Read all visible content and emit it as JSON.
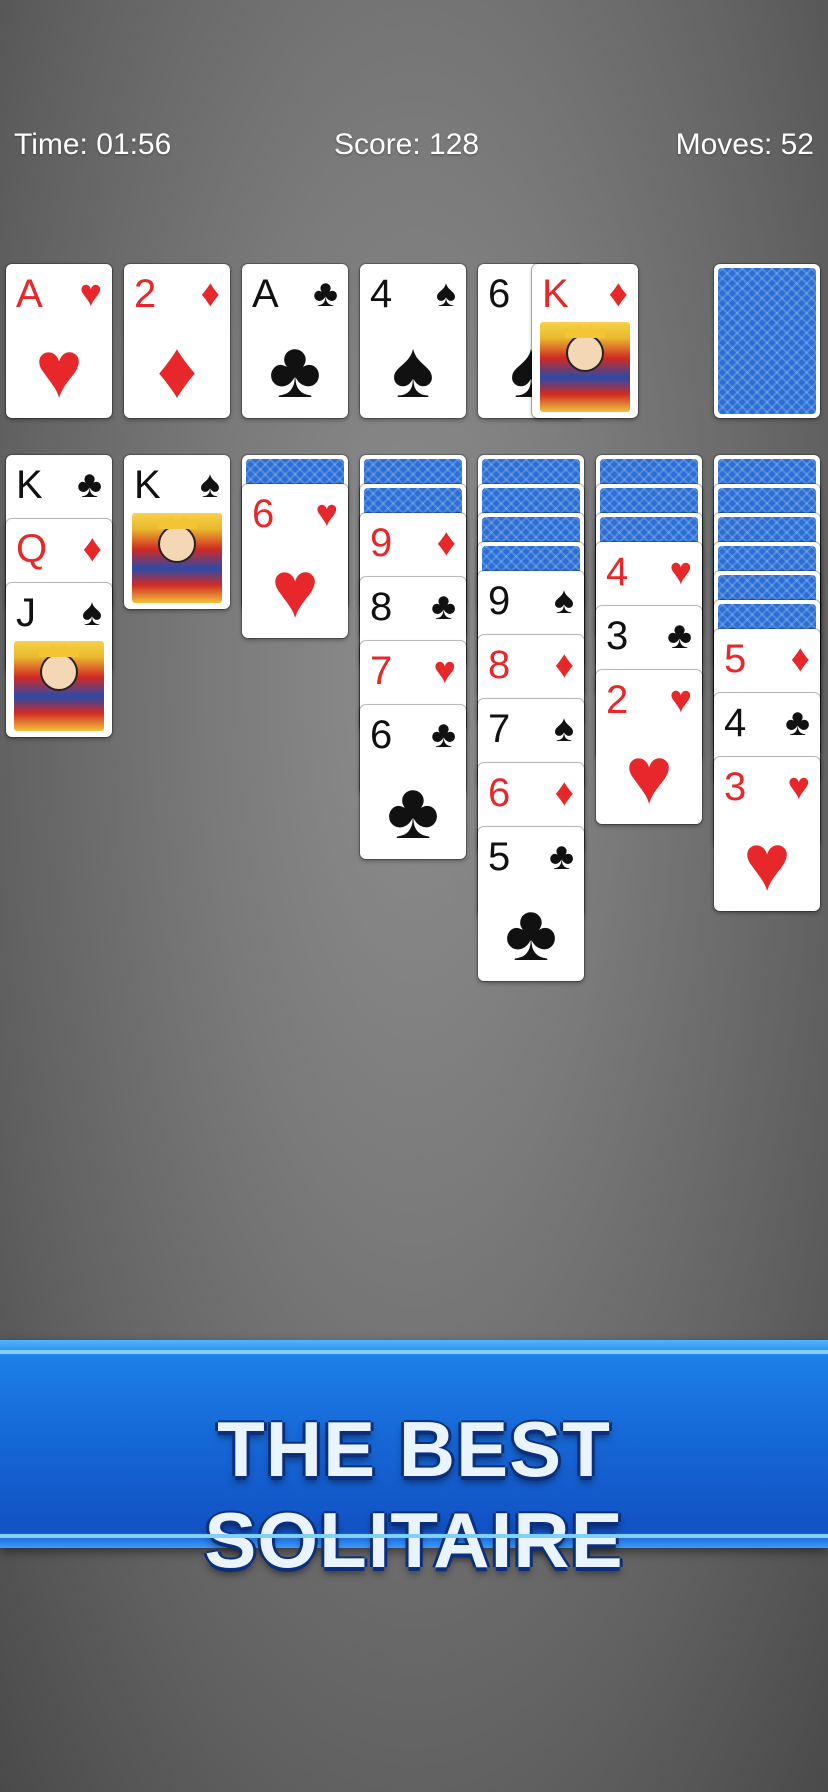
{
  "hud": {
    "time": "Time: 01:56",
    "score": "Score: 128",
    "moves": "Moves: 52"
  },
  "colors": {
    "red_suit": "#e8272b",
    "black_suit": "#111111",
    "card_back": "#2b6fd6",
    "banner": "#1666d6"
  },
  "foundations": [
    {
      "rank": "A",
      "suit": "♥",
      "color": "red"
    },
    {
      "rank": "2",
      "suit": "♦",
      "color": "red"
    },
    {
      "rank": "A",
      "suit": "♣",
      "color": "black"
    },
    {
      "rank": "4",
      "suit": "♠",
      "color": "black"
    }
  ],
  "waste": [
    {
      "rank": "6",
      "suit": "♠",
      "color": "black"
    },
    {
      "rank": "K",
      "suit": "♦",
      "color": "red",
      "face": true
    }
  ],
  "stock": {
    "face_down": true
  },
  "tableau": [
    {
      "hidden": 0,
      "cards": [
        {
          "rank": "K",
          "suit": "♣",
          "color": "black"
        },
        {
          "rank": "Q",
          "suit": "♦",
          "color": "red"
        },
        {
          "rank": "J",
          "suit": "♠",
          "color": "black",
          "face": true
        }
      ]
    },
    {
      "hidden": 0,
      "cards": [
        {
          "rank": "K",
          "suit": "♠",
          "color": "black",
          "face": true
        }
      ]
    },
    {
      "hidden": 1,
      "cards": [
        {
          "rank": "6",
          "suit": "♥",
          "color": "red"
        }
      ]
    },
    {
      "hidden": 2,
      "cards": [
        {
          "rank": "9",
          "suit": "♦",
          "color": "red"
        },
        {
          "rank": "8",
          "suit": "♣",
          "color": "black"
        },
        {
          "rank": "7",
          "suit": "♥",
          "color": "red"
        },
        {
          "rank": "6",
          "suit": "♣",
          "color": "black"
        }
      ]
    },
    {
      "hidden": 4,
      "cards": [
        {
          "rank": "9",
          "suit": "♠",
          "color": "black"
        },
        {
          "rank": "8",
          "suit": "♦",
          "color": "red"
        },
        {
          "rank": "7",
          "suit": "♠",
          "color": "black"
        },
        {
          "rank": "6",
          "suit": "♦",
          "color": "red"
        },
        {
          "rank": "5",
          "suit": "♣",
          "color": "black"
        }
      ]
    },
    {
      "hidden": 3,
      "cards": [
        {
          "rank": "4",
          "suit": "♥",
          "color": "red"
        },
        {
          "rank": "3",
          "suit": "♣",
          "color": "black"
        },
        {
          "rank": "2",
          "suit": "♥",
          "color": "red"
        }
      ]
    },
    {
      "hidden": 6,
      "cards": [
        {
          "rank": "5",
          "suit": "♦",
          "color": "red"
        },
        {
          "rank": "4",
          "suit": "♣",
          "color": "black"
        },
        {
          "rank": "3",
          "suit": "♥",
          "color": "red"
        }
      ]
    }
  ],
  "banner": {
    "text": "THE BEST SOLITAIRE"
  }
}
